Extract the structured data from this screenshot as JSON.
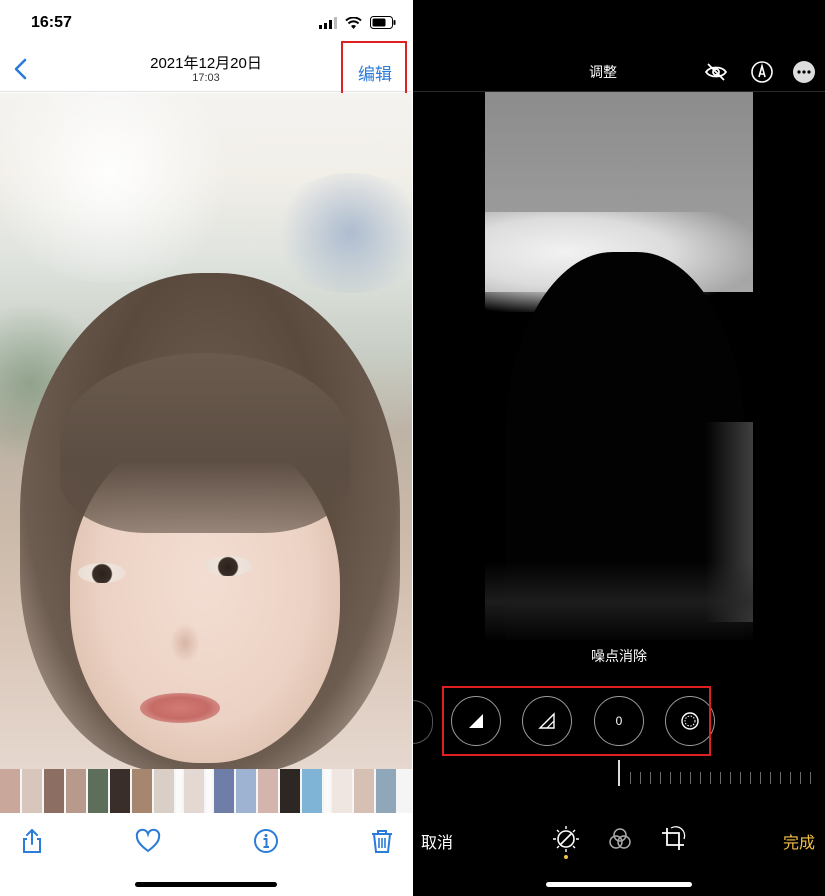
{
  "left_panel": {
    "status_bar": {
      "time": "16:57"
    },
    "nav": {
      "back_label": "",
      "date": "2021年12月20日",
      "time": "17:03",
      "edit_label": "编辑"
    },
    "toolbar": {
      "share": "share-icon",
      "favorite": "heart-icon",
      "info": "info-icon",
      "delete": "trash-icon"
    }
  },
  "right_panel": {
    "header": {
      "title": "调整"
    },
    "caption": "噪点消除",
    "tools": {
      "value_label": "0"
    },
    "bottom": {
      "cancel_label": "取消",
      "done_label": "完成"
    }
  },
  "colors": {
    "accent_blue": "#2b7bd8",
    "accent_yellow": "#f3c047",
    "highlight_red": "#e02020"
  }
}
